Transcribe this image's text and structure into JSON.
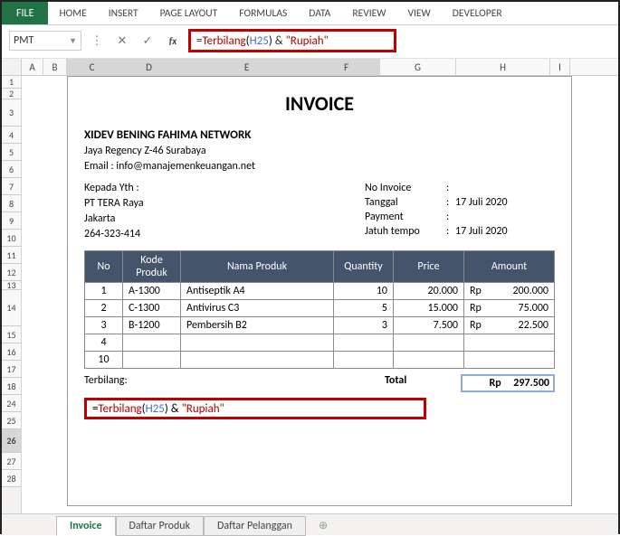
{
  "ribbon": {
    "file": "FILE",
    "tabs": [
      "HOME",
      "INSERT",
      "PAGE LAYOUT",
      "FORMULAS",
      "DATA",
      "REVIEW",
      "VIEW",
      "DEVELOPER"
    ]
  },
  "namebox": "PMT",
  "formula": {
    "raw": "=Terbilang(H25) & \"Rupiah\"",
    "fn": "Terbilang",
    "ref": "H25",
    "str": "\"Rupiah\""
  },
  "columns": [
    "A",
    "B",
    "C",
    "D",
    "E",
    "F",
    "G",
    "H",
    "I"
  ],
  "rows": [
    "",
    "1",
    "2",
    "3",
    "4",
    "5",
    "6",
    "7",
    "8",
    "9",
    "10",
    "11",
    "12",
    "13",
    "14",
    "15",
    "16",
    "17",
    "18",
    "24",
    "25",
    "26",
    "27",
    "28"
  ],
  "active_row": "26",
  "invoice": {
    "title": "INVOICE",
    "company": "XIDEV BENING FAHIMA NETWORK",
    "address": "Jaya Regency Z-46 Surabaya",
    "email_label": "Email : info@manajemenkeuangan.net",
    "to_label": "Kepada Yth :",
    "to_name": "PT TERA Raya",
    "to_city": "Jakarta",
    "to_phone": "264-323-414",
    "meta": [
      {
        "k": "No Invoice",
        "v": ""
      },
      {
        "k": "Tanggal",
        "v": "17 Juli 2020"
      },
      {
        "k": "Payment",
        "v": ""
      },
      {
        "k": "Jatuh tempo",
        "v": "17 Juli 2020"
      }
    ],
    "headers": [
      "No",
      "Kode Produk",
      "Nama Produk",
      "Quantity",
      "Price",
      "Amount"
    ],
    "items": [
      {
        "no": "1",
        "kode": "A-1300",
        "nama": "Antiseptik A4",
        "qty": "10",
        "price": "20.000",
        "cur": "Rp",
        "amt": "200.000"
      },
      {
        "no": "2",
        "kode": "C-1300",
        "nama": "Antivirus  C3",
        "qty": "5",
        "price": "15.000",
        "cur": "Rp",
        "amt": "75.000"
      },
      {
        "no": "3",
        "kode": "B-1200",
        "nama": "Pembersih B2",
        "qty": "3",
        "price": "7.500",
        "cur": "Rp",
        "amt": "22.500"
      },
      {
        "no": "4",
        "kode": "",
        "nama": "",
        "qty": "",
        "price": "",
        "cur": "",
        "amt": ""
      },
      {
        "no": "10",
        "kode": "",
        "nama": "",
        "qty": "",
        "price": "",
        "cur": "",
        "amt": ""
      }
    ],
    "terbilang_label": "Terbilang:",
    "total_label": "Total",
    "total_cur": "Rp",
    "total_amt": "297.500"
  },
  "sheets": [
    "Invoice",
    "Daftar Produk",
    "Daftar Pelanggan"
  ],
  "sheet_add": "⊕"
}
